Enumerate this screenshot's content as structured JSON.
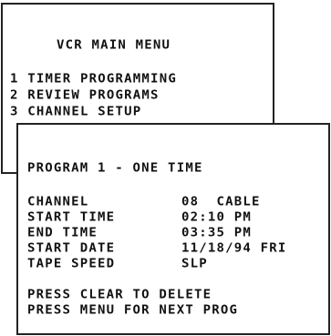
{
  "main_menu": {
    "title": "VCR MAIN MENU",
    "items": [
      {
        "label": "1 TIMER PROGRAMMING"
      },
      {
        "label": "2 REVIEW PROGRAMS"
      },
      {
        "label": "3 CHANNEL SETUP"
      }
    ]
  },
  "program": {
    "title": "PROGRAM 1 - ONE TIME",
    "fields": [
      {
        "label": "CHANNEL",
        "value": "08  CABLE"
      },
      {
        "label": "START TIME",
        "value": "02:10 PM"
      },
      {
        "label": "END TIME",
        "value": "03:35 PM"
      },
      {
        "label": "START DATE",
        "value": "11/18/94 FRI"
      },
      {
        "label": "TAPE SPEED",
        "value": "SLP"
      }
    ],
    "footer": [
      "PRESS CLEAR TO DELETE",
      "PRESS MENU FOR NEXT PROG"
    ]
  }
}
